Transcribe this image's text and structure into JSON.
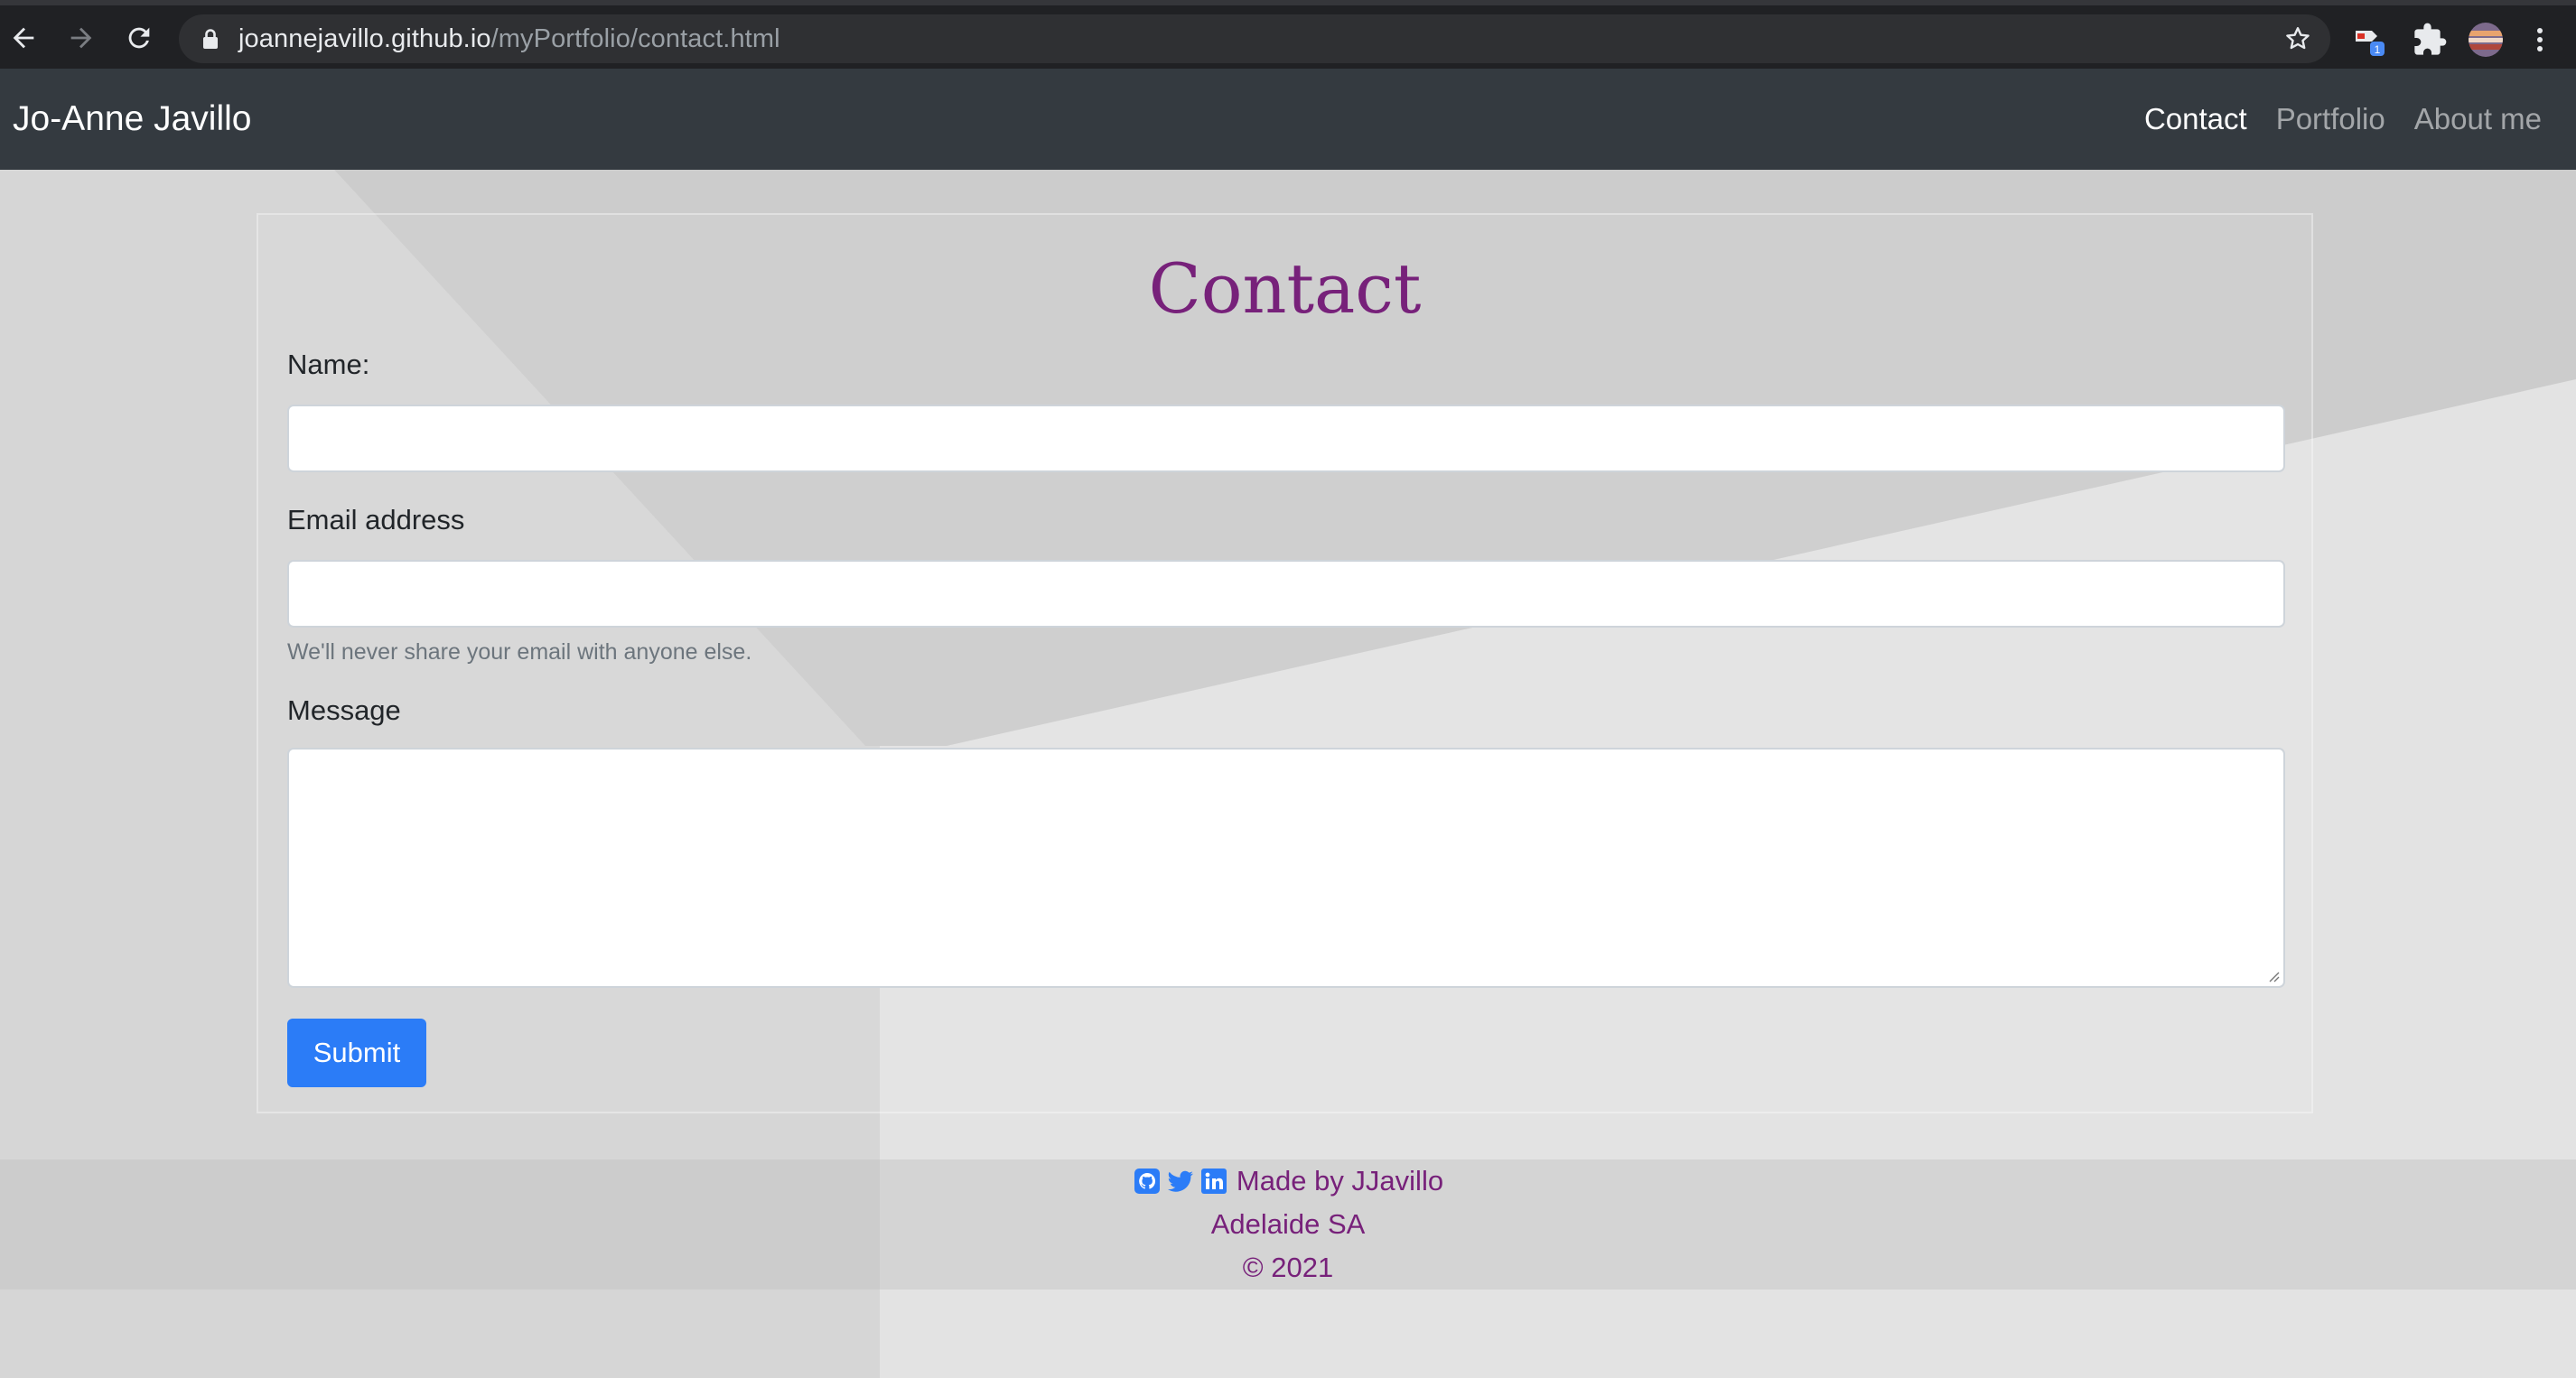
{
  "browser": {
    "url_host": "joannejavillo.github.io",
    "url_path": "/myPortfolio/contact.html",
    "extension_badge": "1"
  },
  "navbar": {
    "brand": "Jo-Anne Javillo",
    "links": [
      {
        "label": "Contact",
        "active": true
      },
      {
        "label": "Portfolio",
        "active": false
      },
      {
        "label": "About me",
        "active": false
      }
    ]
  },
  "form": {
    "title": "Contact",
    "name_label": "Name:",
    "name_value": "",
    "email_label": "Email address",
    "email_value": "",
    "email_help": "We'll never share your email with anyone else.",
    "message_label": "Message",
    "message_value": "",
    "submit_label": "Submit"
  },
  "footer": {
    "social_icons": [
      "github-icon",
      "twitter-icon",
      "linkedin-icon"
    ],
    "credit": "Made by JJavillo",
    "location": "Adelaide SA",
    "copyright": "© 2021"
  },
  "colors": {
    "navbar_bg": "#343a40",
    "accent_purple": "#77217a",
    "button_blue": "#2b7cf7",
    "social_blue": "#2b7cf7"
  }
}
